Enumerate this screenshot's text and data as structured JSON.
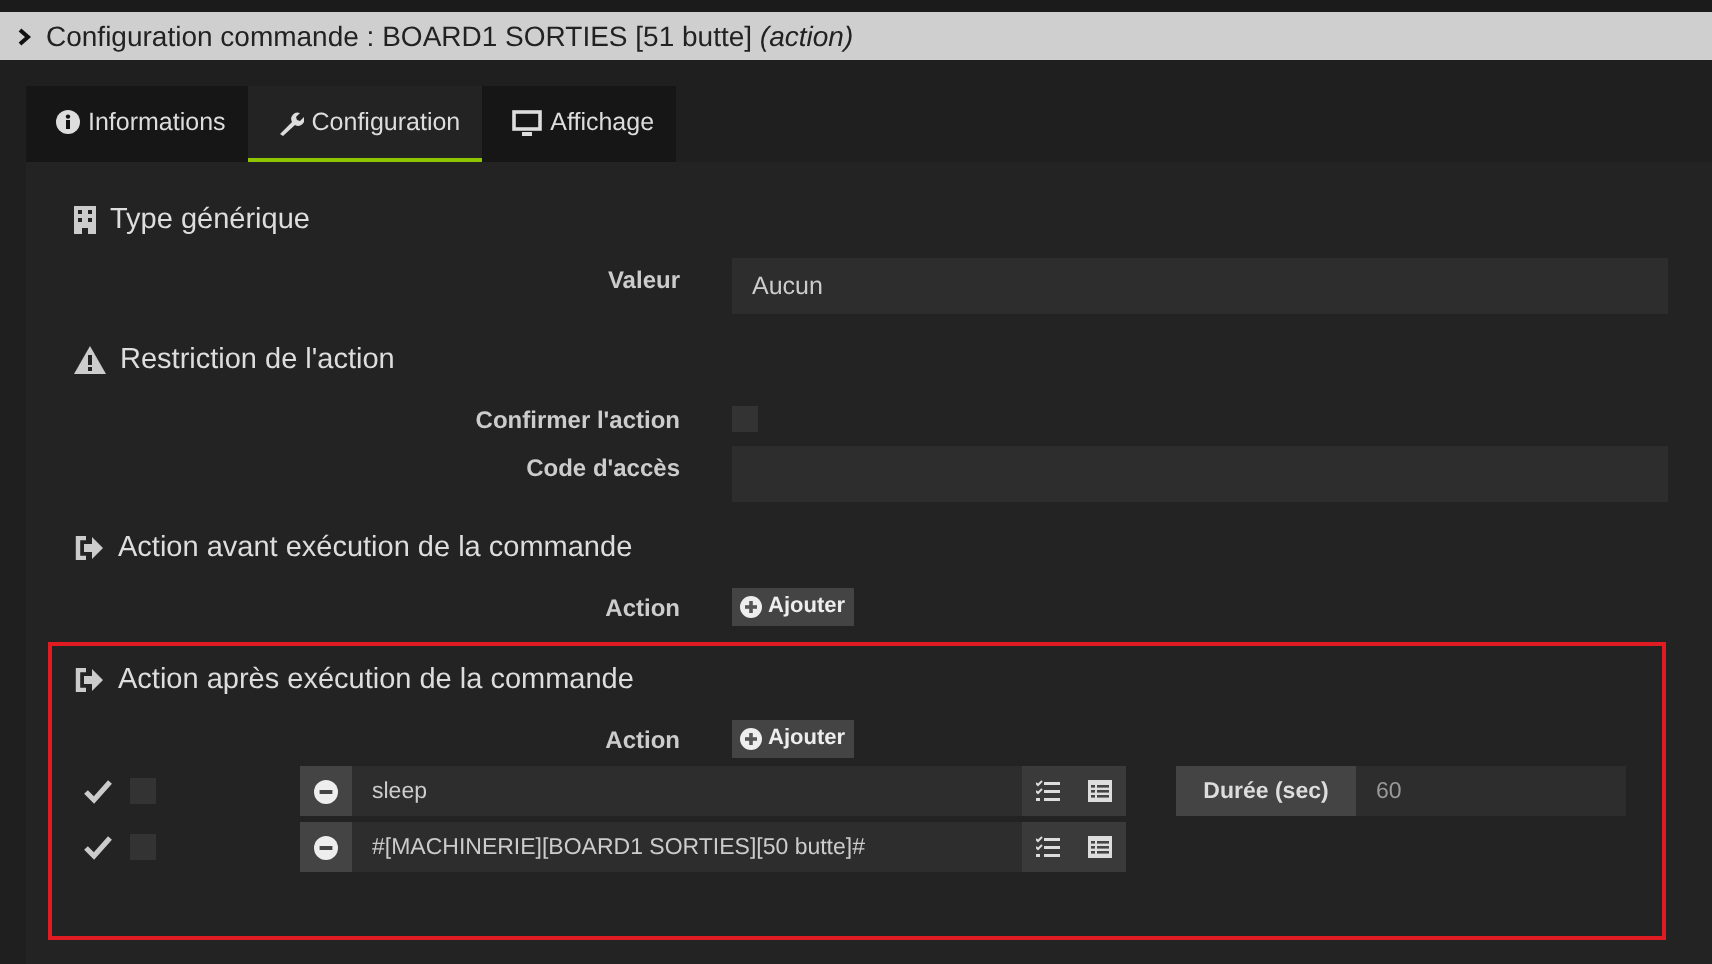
{
  "title": {
    "text": "Configuration commande : BOARD1 SORTIES [51 butte]",
    "suffix": "(action)"
  },
  "tabs": [
    {
      "label": "Informations",
      "selected": false
    },
    {
      "label": "Configuration",
      "selected": true
    },
    {
      "label": "Affichage",
      "selected": false
    }
  ],
  "sections": [
    {
      "kind": "generic",
      "title": "Type générique",
      "highlighted": false,
      "fields": [
        {
          "kind": "select",
          "label": "Valeur",
          "value": "Aucun"
        }
      ]
    },
    {
      "kind": "restriction",
      "title": "Restriction de l'action",
      "highlighted": false,
      "fields": [
        {
          "kind": "checkbox",
          "label": "Confirmer l'action",
          "checked": false
        },
        {
          "kind": "text",
          "label": "Code d'accès"
        }
      ]
    },
    {
      "kind": "action",
      "title": "Action avant exécution de la commande",
      "highlighted": false,
      "fields": [
        {
          "kind": "add",
          "label": "Action",
          "button": "Ajouter"
        }
      ]
    },
    {
      "kind": "action",
      "title": "Action après exécution de la commande",
      "highlighted": true,
      "fields": [
        {
          "kind": "add",
          "label": "Action",
          "button": "Ajouter"
        }
      ],
      "actions": [
        {
          "enabled": true,
          "background": false,
          "command": "sleep",
          "options": [
            {
              "label": "Durée (sec)",
              "value": "60"
            }
          ]
        },
        {
          "enabled": true,
          "background": false,
          "command": "#[MACHINERIE][BOARD1 SORTIES][50 butte]#"
        }
      ]
    }
  ]
}
